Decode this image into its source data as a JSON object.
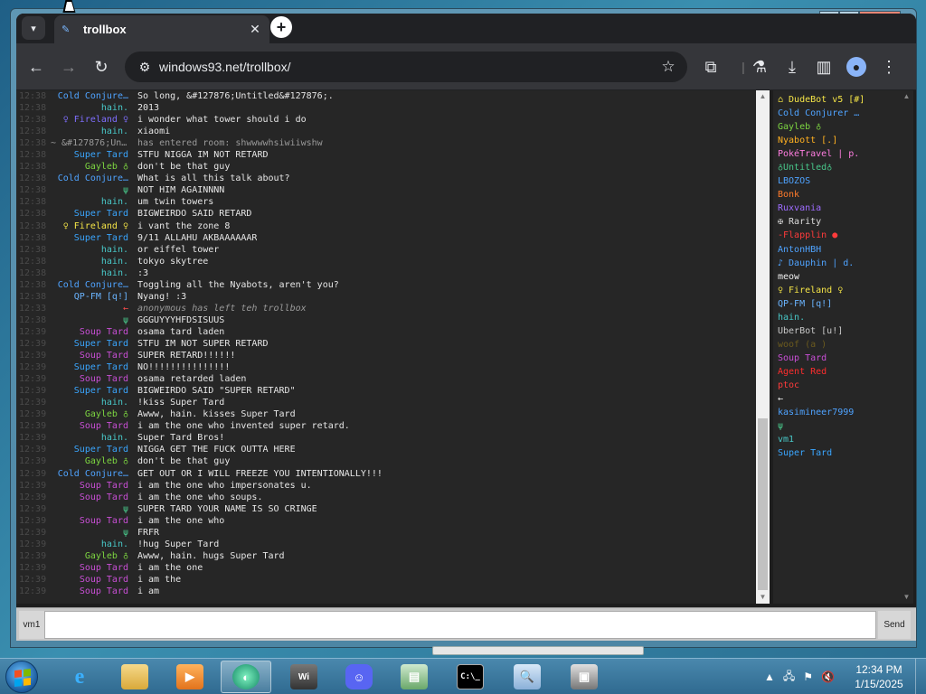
{
  "browser": {
    "tab_title": "trollbox",
    "url": "windows93.net/trollbox/"
  },
  "chat": {
    "messages": [
      {
        "time": "12:38",
        "nick": "Cold Conjure…",
        "color": "#4fa3ff",
        "text": "So long, &#127876;Untitled&#127876;."
      },
      {
        "time": "12:38",
        "nick": "hain.",
        "color": "#48c7c7",
        "text": "2013"
      },
      {
        "time": "12:38",
        "nick": "♀ Fireland ♀",
        "color": "#7f6fff",
        "text": "i wonder what tower should i do"
      },
      {
        "time": "12:38",
        "nick": "hain.",
        "color": "#48c7c7",
        "text": "xiaomi"
      },
      {
        "time": "12:38",
        "nick": "~ &#127876;Untit…",
        "color": "#9a9a9a",
        "text": "has entered room: shwwwwhsiwiiwshw"
      },
      {
        "time": "12:38",
        "nick": "Super Tard",
        "color": "#3aa6ff",
        "text": "STFU NIGGA IM NOT RETARD"
      },
      {
        "time": "12:38",
        "nick": "Gayleb ♁",
        "color": "#7dd641",
        "text": "don't be that guy"
      },
      {
        "time": "12:38",
        "nick": "Cold Conjure…",
        "color": "#4fa3ff",
        "text": "What is all this talk about?"
      },
      {
        "time": "12:38",
        "nick": "ψ",
        "color": "#48c78a",
        "text": "NOT HIM AGAINNNN"
      },
      {
        "time": "12:38",
        "nick": "hain.",
        "color": "#48c7c7",
        "text": "um twin towers"
      },
      {
        "time": "12:38",
        "nick": "Super Tard",
        "color": "#3aa6ff",
        "text": "BIGWEIRDO SAID RETARD"
      },
      {
        "time": "12:38",
        "nick": "♀ Fireland ♀",
        "color": "#f5e547",
        "text": "i vant the zone 8"
      },
      {
        "time": "12:38",
        "nick": "Super Tard",
        "color": "#3aa6ff",
        "text": "9/11 ALLAHU AKBAAAAAAR"
      },
      {
        "time": "12:38",
        "nick": "hain.",
        "color": "#48c7c7",
        "text": "or eiffel tower"
      },
      {
        "time": "12:38",
        "nick": "hain.",
        "color": "#48c7c7",
        "text": "tokyo skytree"
      },
      {
        "time": "12:38",
        "nick": "hain.",
        "color": "#48c7c7",
        "text": ":3"
      },
      {
        "time": "12:38",
        "nick": "Cold Conjure…",
        "color": "#4fa3ff",
        "text": "Toggling all the Nyabots, aren't you?"
      },
      {
        "time": "12:38",
        "nick": "QP-FM [q!]",
        "color": "#6ab4ff",
        "text": "Nyang! :3"
      },
      {
        "time": "12:33",
        "nick": "←",
        "color": "#ff4d4d",
        "text": "anonymous has left teh trollbox"
      },
      {
        "time": "12:38",
        "nick": "ψ",
        "color": "#48c78a",
        "text": "GGGUYYYHFDSISUUS"
      },
      {
        "time": "12:39",
        "nick": "Soup Tard",
        "color": "#c94fd6",
        "text": "osama tard laden"
      },
      {
        "time": "12:39",
        "nick": "Super Tard",
        "color": "#3aa6ff",
        "text": "STFU IM NOT SUPER RETARD"
      },
      {
        "time": "12:39",
        "nick": "Soup Tard",
        "color": "#c94fd6",
        "text": "SUPER RETARD!!!!!!"
      },
      {
        "time": "12:39",
        "nick": "Super Tard",
        "color": "#3aa6ff",
        "text": "NO!!!!!!!!!!!!!!!"
      },
      {
        "time": "12:39",
        "nick": "Soup Tard",
        "color": "#c94fd6",
        "text": "osama retarded laden"
      },
      {
        "time": "12:39",
        "nick": "Super Tard",
        "color": "#3aa6ff",
        "text": "BIGWEIRDO SAID \"SUPER RETARD\""
      },
      {
        "time": "12:39",
        "nick": "hain.",
        "color": "#48c7c7",
        "text": "!kiss Super Tard"
      },
      {
        "time": "12:39",
        "nick": "Gayleb ♁",
        "color": "#7dd641",
        "text": "Awww, hain. kisses Super Tard"
      },
      {
        "time": "12:39",
        "nick": "Soup Tard",
        "color": "#c94fd6",
        "text": "i am the one who invented super retard."
      },
      {
        "time": "12:39",
        "nick": "hain.",
        "color": "#48c7c7",
        "text": "Super Tard Bros!"
      },
      {
        "time": "12:39",
        "nick": "Super Tard",
        "color": "#3aa6ff",
        "text": "NIGGA GET THE FUCK OUTTA HERE"
      },
      {
        "time": "12:39",
        "nick": "Gayleb ♁",
        "color": "#7dd641",
        "text": "don't be that guy"
      },
      {
        "time": "12:39",
        "nick": "Cold Conjure…",
        "color": "#4fa3ff",
        "text": "GET OUT OR I WILL FREEZE YOU INTENTIONALLY!!!"
      },
      {
        "time": "12:39",
        "nick": "Soup Tard",
        "color": "#c94fd6",
        "text": "i am the one who impersonates u."
      },
      {
        "time": "12:39",
        "nick": "Soup Tard",
        "color": "#c94fd6",
        "text": "i am the one who soups."
      },
      {
        "time": "12:39",
        "nick": "ψ",
        "color": "#48c78a",
        "text": "SUPER TARD YOUR NAME IS SO CRINGE"
      },
      {
        "time": "12:39",
        "nick": "Soup Tard",
        "color": "#c94fd6",
        "text": "i am the one who"
      },
      {
        "time": "12:39",
        "nick": "ψ",
        "color": "#48c78a",
        "text": "FRFR"
      },
      {
        "time": "12:39",
        "nick": "hain.",
        "color": "#48c7c7",
        "text": "!hug Super Tard"
      },
      {
        "time": "12:39",
        "nick": "Gayleb ♁",
        "color": "#7dd641",
        "text": "Awww, hain. hugs Super Tard"
      },
      {
        "time": "12:39",
        "nick": "Soup Tard",
        "color": "#c94fd6",
        "text": "i am the one"
      },
      {
        "time": "12:39",
        "nick": "Soup Tard",
        "color": "#c94fd6",
        "text": "i am the"
      },
      {
        "time": "12:39",
        "nick": "Soup Tard",
        "color": "#c94fd6",
        "text": "i am"
      }
    ],
    "input_nick": "vm1",
    "send_label": "Send"
  },
  "users": [
    {
      "name": "⌂ DudeBot v5 [#]",
      "color": "#f5e547"
    },
    {
      "name": "Cold Conjurer …",
      "color": "#4fa3ff"
    },
    {
      "name": "Gayleb ♁",
      "color": "#7dd641"
    },
    {
      "name": "Nyabott [.]",
      "color": "#ffb020"
    },
    {
      "name": "PokéTravel | p.",
      "color": "#ff7de0"
    },
    {
      "name": "♁Untitled♁",
      "color": "#48c78a"
    },
    {
      "name": "LBOZOS",
      "color": "#4fa3ff"
    },
    {
      "name": "Bonk",
      "color": "#ff7b2b"
    },
    {
      "name": "Ruxvania",
      "color": "#9e6cff"
    },
    {
      "name": "✠ Rarity",
      "color": "#dcdcdc"
    },
    {
      "name": "-Flapplin ●",
      "color": "#ff3b3b"
    },
    {
      "name": "AntonHBH",
      "color": "#4fa3ff"
    },
    {
      "name": "♪ Dauphin | d.",
      "color": "#4fa3ff"
    },
    {
      "name": "meow",
      "color": "#f0f0f0"
    },
    {
      "name": "♀ Fireland ♀",
      "color": "#f5e547"
    },
    {
      "name": "QP-FM [q!]",
      "color": "#6ab4ff"
    },
    {
      "name": "hain.",
      "color": "#48c7c7"
    },
    {
      "name": "UberBot [u!]",
      "color": "#c8c8c8"
    },
    {
      "name": "woof (a )",
      "color": "#6b5a1e"
    },
    {
      "name": "Soup Tard",
      "color": "#c94fd6"
    },
    {
      "name": "Agent Red",
      "color": "#ff2d2d"
    },
    {
      "name": "ptoc",
      "color": "#ff3b3b"
    },
    {
      "name": "←",
      "color": "#f0f0f0"
    },
    {
      "name": "kasimineer7999",
      "color": "#4fa3ff"
    },
    {
      "name": "ψ",
      "color": "#48c78a"
    },
    {
      "name": "vm1",
      "color": "#48c7c7"
    },
    {
      "name": "Super Tard",
      "color": "#3aa6ff"
    }
  ],
  "taskbar": {
    "time": "12:34 PM",
    "date": "1/15/2025"
  }
}
